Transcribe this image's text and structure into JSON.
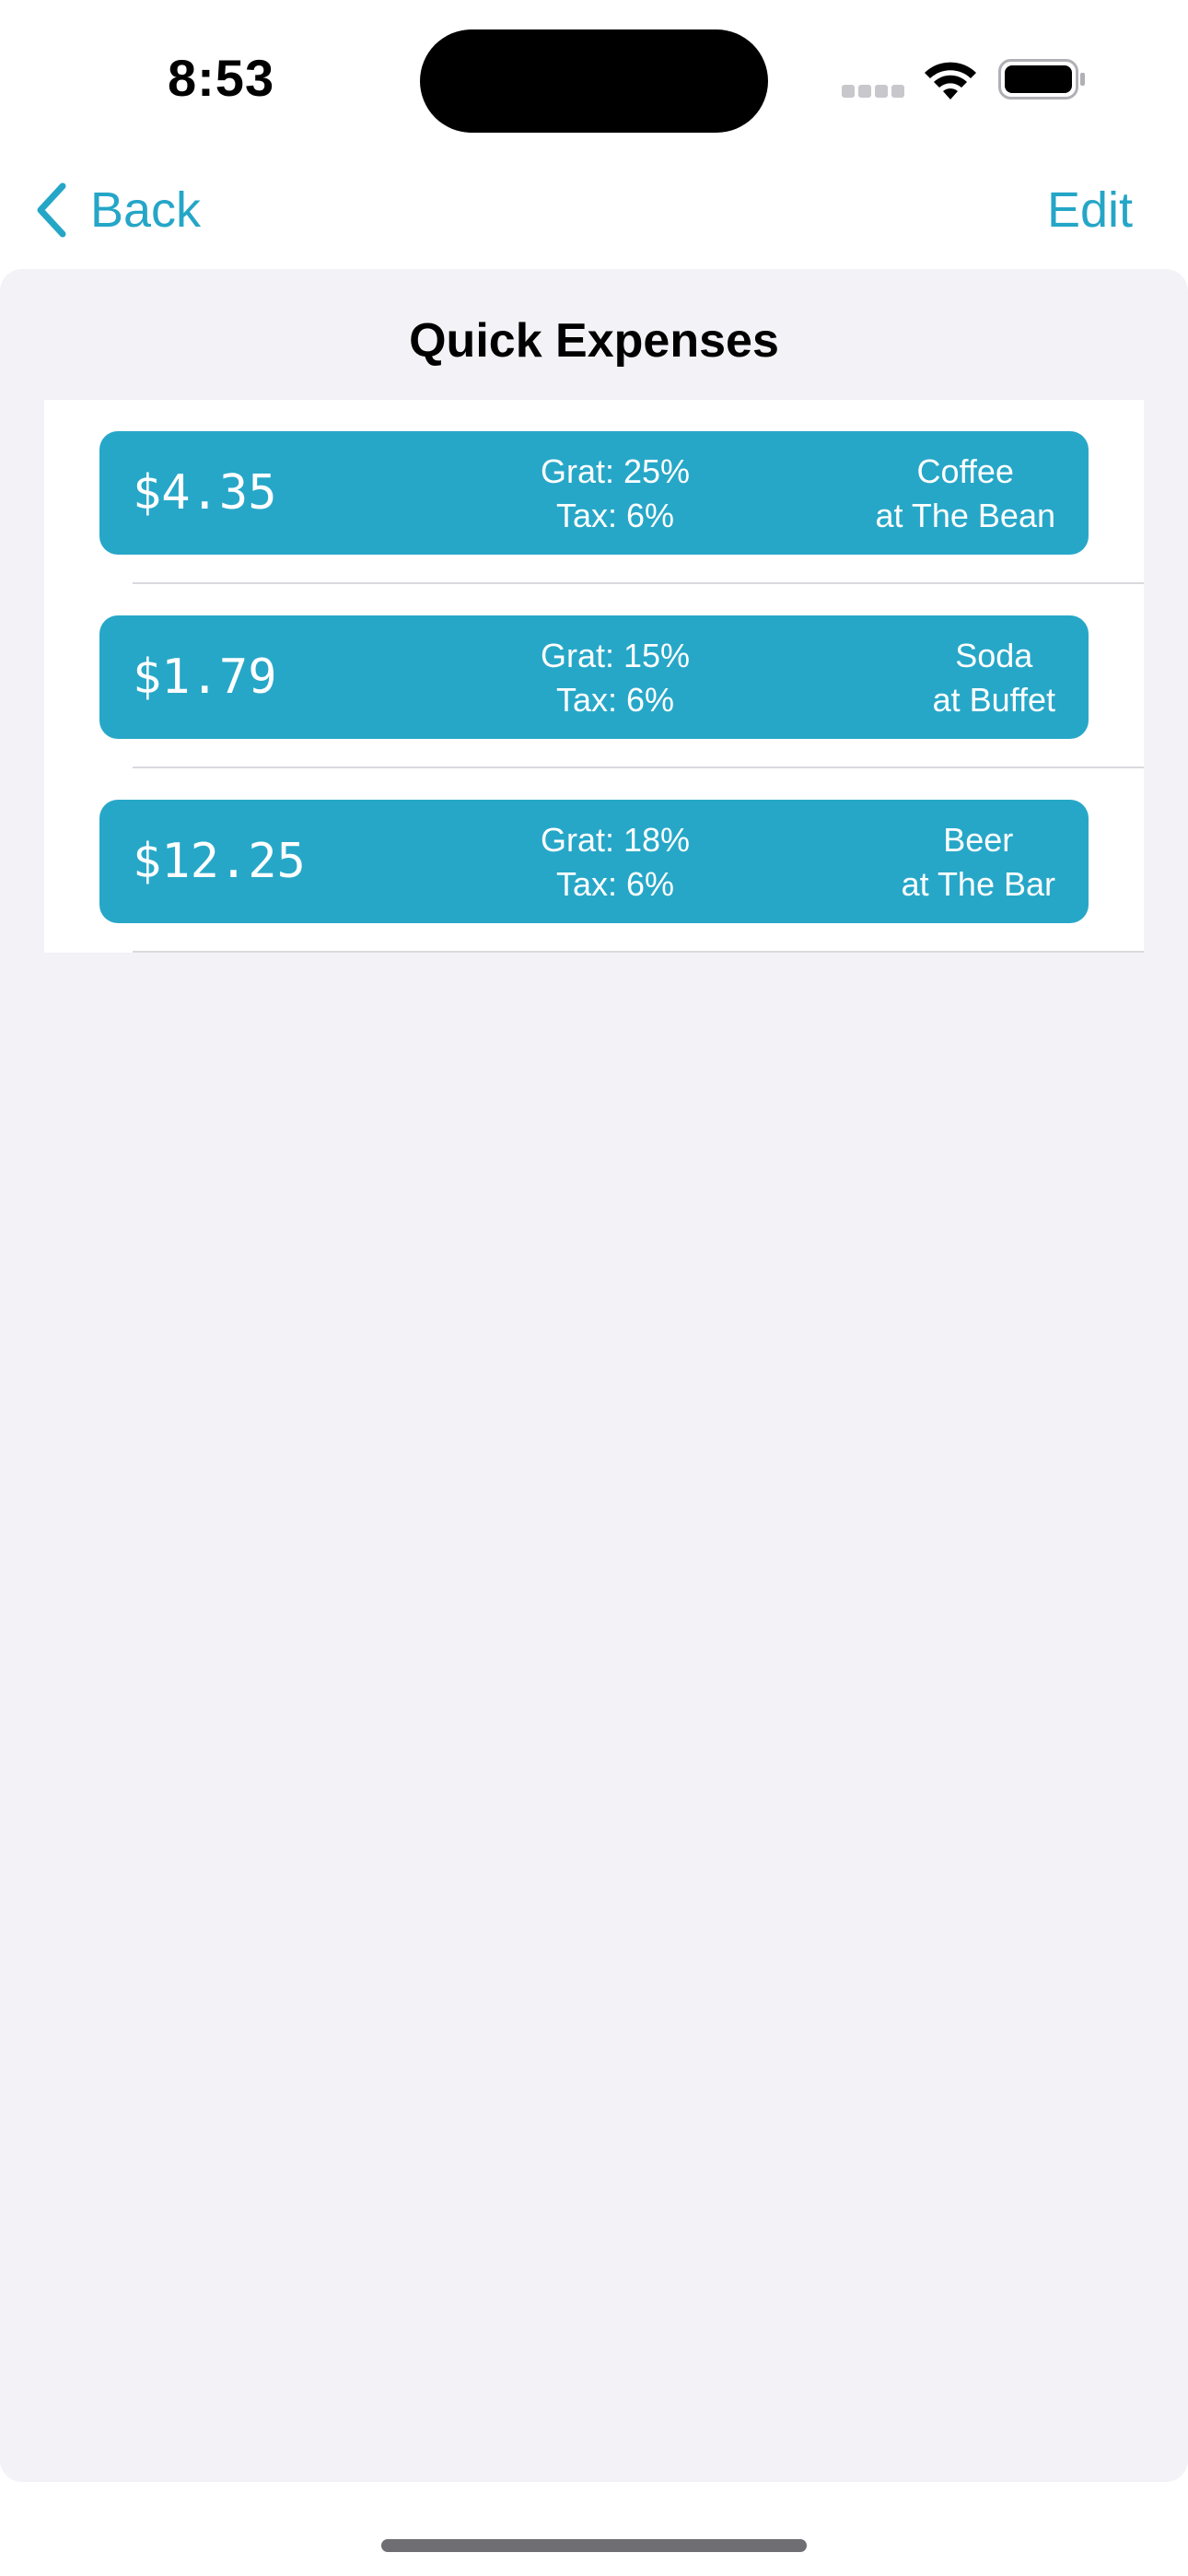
{
  "status_bar": {
    "time": "8:53",
    "icons": [
      "cellular-signal-icon",
      "wifi-icon",
      "battery-icon"
    ]
  },
  "nav": {
    "back_label": "Back",
    "edit_label": "Edit"
  },
  "sheet": {
    "title": "Quick Expenses"
  },
  "expenses": [
    {
      "amount": "$4.35",
      "grat": "Grat: 25%",
      "tax": "Tax: 6%",
      "item": "Coffee",
      "place": "at The Bean"
    },
    {
      "amount": "$1.79",
      "grat": "Grat: 15%",
      "tax": "Tax: 6%",
      "item": "Soda",
      "place": "at Buffet"
    },
    {
      "amount": "$12.25",
      "grat": "Grat: 18%",
      "tax": "Tax: 6%",
      "item": "Beer",
      "place": "at The Bar"
    }
  ],
  "colors": {
    "accent": "#25a6c7",
    "card": "#27a7c8",
    "sheet_background": "#f2f2f7"
  }
}
